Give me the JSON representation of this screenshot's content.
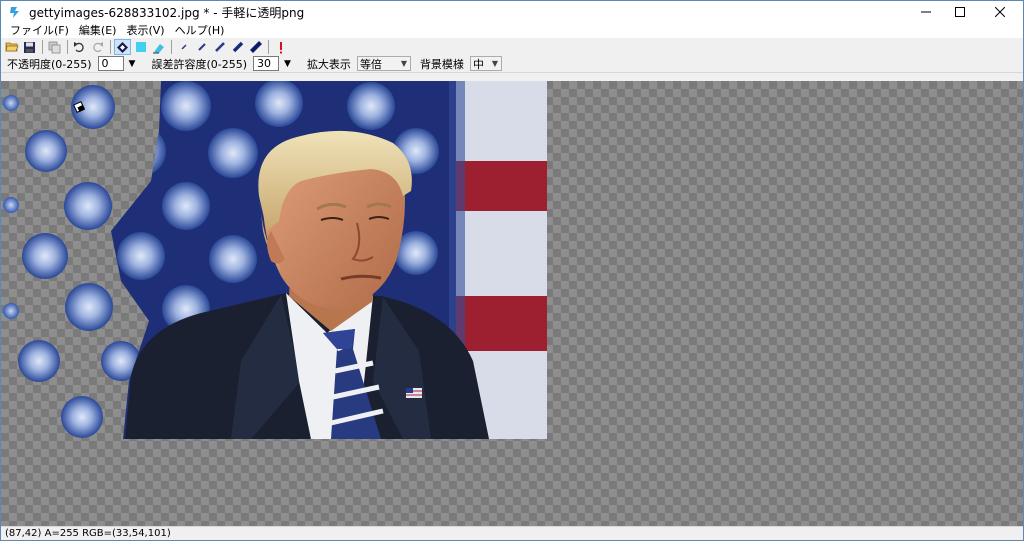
{
  "window": {
    "title": "gettyimages-628833102.jpg * - 手軽に透明png",
    "controls": {
      "minimize": "—",
      "maximize": "☐",
      "close": "✕"
    }
  },
  "menu": [
    {
      "label": "ファイル(F)"
    },
    {
      "label": "編集(E)"
    },
    {
      "label": "表示(V)"
    },
    {
      "label": "ヘルプ(H)"
    }
  ],
  "toolbar": {
    "buttons": [
      {
        "name": "open-icon"
      },
      {
        "name": "save-icon"
      },
      {
        "name": "copy-icon"
      },
      {
        "name": "undo-icon"
      },
      {
        "name": "redo-icon"
      },
      {
        "name": "fill-transparent-icon",
        "active": true
      },
      {
        "name": "cyan-square-icon"
      },
      {
        "name": "eraser-icon"
      },
      {
        "name": "pen-size-1-icon"
      },
      {
        "name": "pen-size-2-icon"
      },
      {
        "name": "pen-size-3-icon"
      },
      {
        "name": "pen-size-4-icon"
      },
      {
        "name": "pen-size-5-icon"
      },
      {
        "name": "alert-icon"
      }
    ]
  },
  "options": {
    "opacity_label": "不透明度(0-255)",
    "opacity_value": "0",
    "tolerance_label": "誤差許容度(0-255)",
    "tolerance_value": "30",
    "zoom_label": "拡大表示",
    "zoom_value": "等倍",
    "bg_pattern_label": "背景模様",
    "bg_pattern_value": "中",
    "spin_arrow": "▼"
  },
  "status": {
    "text": "(87,42) A=255 RGB=(33,54,101)"
  },
  "colors": {
    "accent": "#0078d7",
    "flag_blue": "#1e2f78",
    "flag_red": "#9c2030",
    "suit": "#1a2030",
    "tie_blue": "#283a80"
  }
}
